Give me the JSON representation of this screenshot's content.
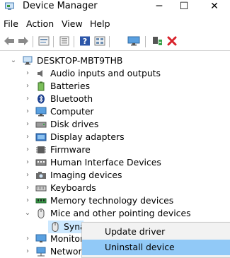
{
  "window": {
    "title": "Device Manager",
    "minimize_glyph": "─",
    "maximize_glyph": "☐",
    "close_glyph": "✕"
  },
  "menu": {
    "file": "File",
    "action": "Action",
    "view": "View",
    "help": "Help"
  },
  "toolbar": [
    "back-arrow-icon",
    "forward-arrow-icon",
    "properties-icon",
    "show-hidden-icon",
    "help-icon",
    "view-grid-icon",
    "monitor-icon",
    "scan-hardware-icon",
    "uninstall-x-icon"
  ],
  "tree": {
    "root": "DESKTOP-MBT9THB",
    "categories": [
      {
        "label": "Audio inputs and outputs",
        "icon": "speaker-icon"
      },
      {
        "label": "Batteries",
        "icon": "battery-icon"
      },
      {
        "label": "Bluetooth",
        "icon": "bluetooth-icon"
      },
      {
        "label": "Computer",
        "icon": "computer-icon"
      },
      {
        "label": "Disk drives",
        "icon": "disk-drive-icon"
      },
      {
        "label": "Display adapters",
        "icon": "display-adapter-icon"
      },
      {
        "label": "Firmware",
        "icon": "firmware-icon"
      },
      {
        "label": "Human Interface Devices",
        "icon": "hid-icon"
      },
      {
        "label": "Imaging devices",
        "icon": "camera-icon"
      },
      {
        "label": "Keyboards",
        "icon": "keyboard-icon"
      },
      {
        "label": "Memory technology devices",
        "icon": "memory-icon"
      },
      {
        "label": "Mice and other pointing devices",
        "icon": "mouse-icon",
        "expanded": true
      }
    ],
    "child": {
      "label": "Syna",
      "icon": "mouse-icon"
    },
    "after": [
      {
        "label": "Monitor",
        "icon": "monitor-icon"
      },
      {
        "label": "Networ",
        "icon": "network-icon"
      }
    ]
  },
  "context_menu": {
    "update": "Update driver",
    "uninstall": "Uninstall device"
  },
  "colors": {
    "highlight": "#91c9f7",
    "selected_row": "#cce8ff",
    "menu_bg": "#f2f2f2"
  }
}
